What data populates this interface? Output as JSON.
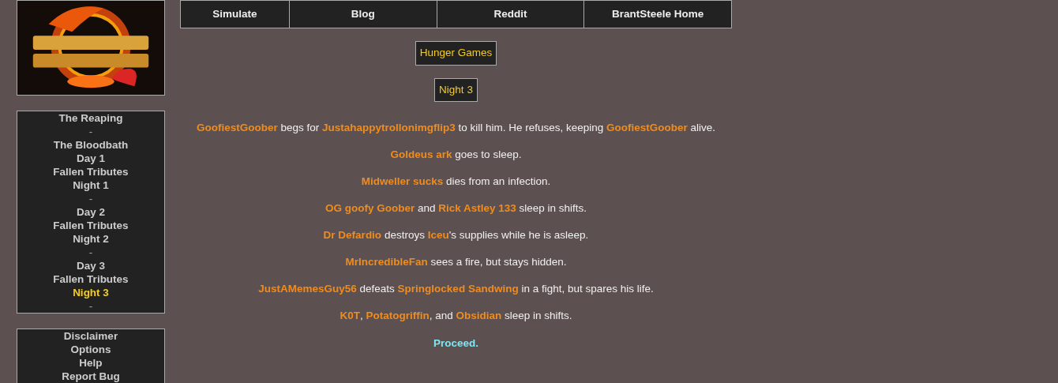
{
  "nav": [
    {
      "label": "Simulate"
    },
    {
      "label": "Blog"
    },
    {
      "label": "Reddit"
    },
    {
      "label": "BrantSteele Home"
    }
  ],
  "phases": [
    {
      "label": "The Reaping",
      "selected": false
    },
    {
      "label": "-",
      "selected": false
    },
    {
      "label": "The Bloodbath",
      "selected": false
    },
    {
      "label": "Day 1",
      "selected": false
    },
    {
      "label": "Fallen Tributes",
      "selected": false
    },
    {
      "label": "Night 1",
      "selected": false
    },
    {
      "label": "-",
      "selected": false
    },
    {
      "label": "Day 2",
      "selected": false
    },
    {
      "label": "Fallen Tributes",
      "selected": false
    },
    {
      "label": "Night 2",
      "selected": false
    },
    {
      "label": "-",
      "selected": false
    },
    {
      "label": "Day 3",
      "selected": false
    },
    {
      "label": "Fallen Tributes",
      "selected": false
    },
    {
      "label": "Night 3",
      "selected": true
    },
    {
      "label": "-",
      "selected": false
    }
  ],
  "links": [
    "Disclaimer",
    "Options",
    "Help",
    "Report Bug"
  ],
  "game_title": "Hunger Games",
  "phase_title": "Night 3",
  "events": [
    "**GoofiestGoober** begs for **Justahappytrollonimgflip3** to kill him. He refuses, keeping **GoofiestGoober** alive.",
    "**Goldeus ark** goes to sleep.",
    "**Midweller sucks** dies from an infection.",
    "**OG goofy Goober** and **Rick Astley 133** sleep in shifts.",
    "**Dr Defardio** destroys **Iceu**'s supplies while he is asleep.",
    "**MrIncredibleFan** sees a fire, but stays hidden.",
    "**JustAMemesGuy56** defeats **Springlocked Sandwing** in a fight, but spares his life.",
    "**K0T**, **Potatogriffin**, and **Obsidian** sleep in shifts."
  ],
  "proceed": "Proceed."
}
